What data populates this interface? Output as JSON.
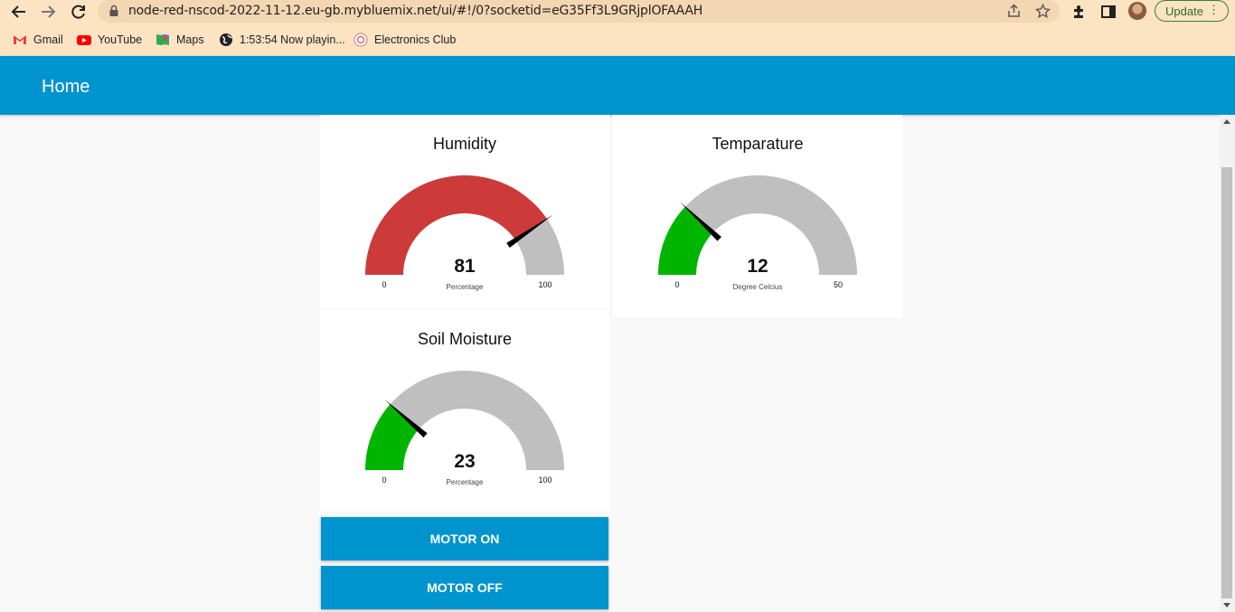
{
  "browser": {
    "url": "node-red-nscod-2022-11-12.eu-gb.mybluemix.net/ui/#!/0?socketid=eG35Ff3L9GRjplOFAAAH",
    "update_label": "Update",
    "bookmarks": [
      {
        "label": "Gmail",
        "icon": "gmail-icon"
      },
      {
        "label": "YouTube",
        "icon": "youtube-icon"
      },
      {
        "label": "Maps",
        "icon": "maps-icon"
      },
      {
        "label": "1:53:54 Now playin...",
        "icon": "globe-icon"
      },
      {
        "label": "Electronics Club",
        "icon": "electronics-club-icon"
      }
    ]
  },
  "header": {
    "title": "Home"
  },
  "gauges": [
    {
      "title": "Humidity",
      "value": 81,
      "unit": "Percentage",
      "min": 0,
      "max": 100,
      "min_label": "0",
      "max_label": "100",
      "value_label": "81",
      "fill_color": "#cc3a3a"
    },
    {
      "title": "Temparature",
      "value": 12,
      "unit": "Degree Celcius",
      "min": 0,
      "max": 50,
      "min_label": "0",
      "max_label": "50",
      "value_label": "12",
      "fill_color": "#00b500"
    },
    {
      "title": "Soil Moisture",
      "value": 23,
      "unit": "Percentage",
      "min": 0,
      "max": 100,
      "min_label": "0",
      "max_label": "100",
      "value_label": "23",
      "fill_color": "#00b500"
    }
  ],
  "buttons": {
    "motor_on": "MOTOR ON",
    "motor_off": "MOTOR OFF"
  },
  "colors": {
    "accent": "#0094ce",
    "gauge_track": "#bfbfbf",
    "needle": "#000000"
  }
}
